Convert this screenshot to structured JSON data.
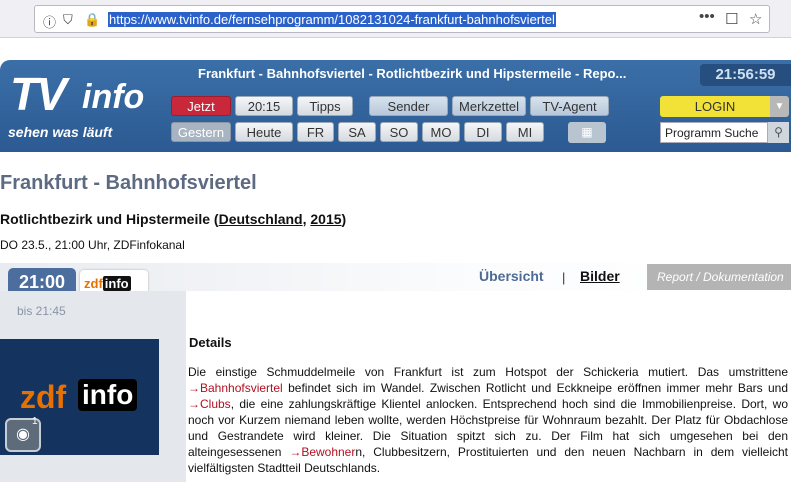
{
  "browser": {
    "url": "https://www.tvinfo.de/fernsehprogramm/1082131024-frankfurt-bahnhofsviertel",
    "more_icon": "•••"
  },
  "site": {
    "logo_tv": "TV",
    "logo_info": "info",
    "slogan": "sehen was läuft",
    "strip_title": "Frankfurt - Bahnhofsviertel - Rotlichtbezirk und Hipstermeile - Repo...",
    "clock": "21:56:59"
  },
  "nav": {
    "row1": [
      "Jetzt",
      "20:15",
      "Tipps",
      "Sender",
      "Merkzettel",
      "TV-Agent"
    ],
    "row2": [
      "Gestern",
      "Heute",
      "FR",
      "SA",
      "SO",
      "MO",
      "DI",
      "MI"
    ],
    "login": "LOGIN",
    "search_placeholder": "Programm Suche"
  },
  "show": {
    "title": "Frankfurt - Bahnhofsviertel",
    "subtitle_prefix": "Rotlichtbezirk und Hipstermeile (",
    "country": "Deutschland",
    "year": "2015",
    "subtitle_suffix": ")",
    "air_info": "DO 23.5., 21:00 Uhr, ZDFinfokanal",
    "start_time": "21:00",
    "end_time": "bis 21:45",
    "channel_badge_a": "zdf",
    "channel_badge_b": "info",
    "genre": "Report / Dokumentation",
    "photo_count": "1"
  },
  "tabs": {
    "overview": "Übersicht",
    "separator": "|",
    "pictures": "Bilder"
  },
  "details": {
    "heading": "Details",
    "p1": "Die einstige Schmuddelmeile von Frankfurt ist zum Hotspot der Schickeria mutiert. Das umstrittene",
    "link1": "Bahnhofsviertel",
    "p2": "befindet sich im Wandel. Zwischen Rotlicht und Eckkneipe eröffnen immer mehr Bars und",
    "link2": "Clubs",
    "p3": ", die eine zahlungskräftige Klientel anlocken. Entsprechend hoch sind die Immobilienpreise. Dort, wo noch vor Kurzem niemand leben wollte, werden Höchstpreise für Wohnraum bezahlt. Der Platz für Obdachlose und Gestrandete wird kleiner. Die Situation spitzt sich zu. Der Film hat sich umgesehen bei den alteingesessenen",
    "link3": "Bewohner",
    "p4": "n, Clubbesitzern, Prostituierten und den neuen Nachbarn in dem vielleicht vielfältigsten Stadtteil Deutschlands."
  }
}
